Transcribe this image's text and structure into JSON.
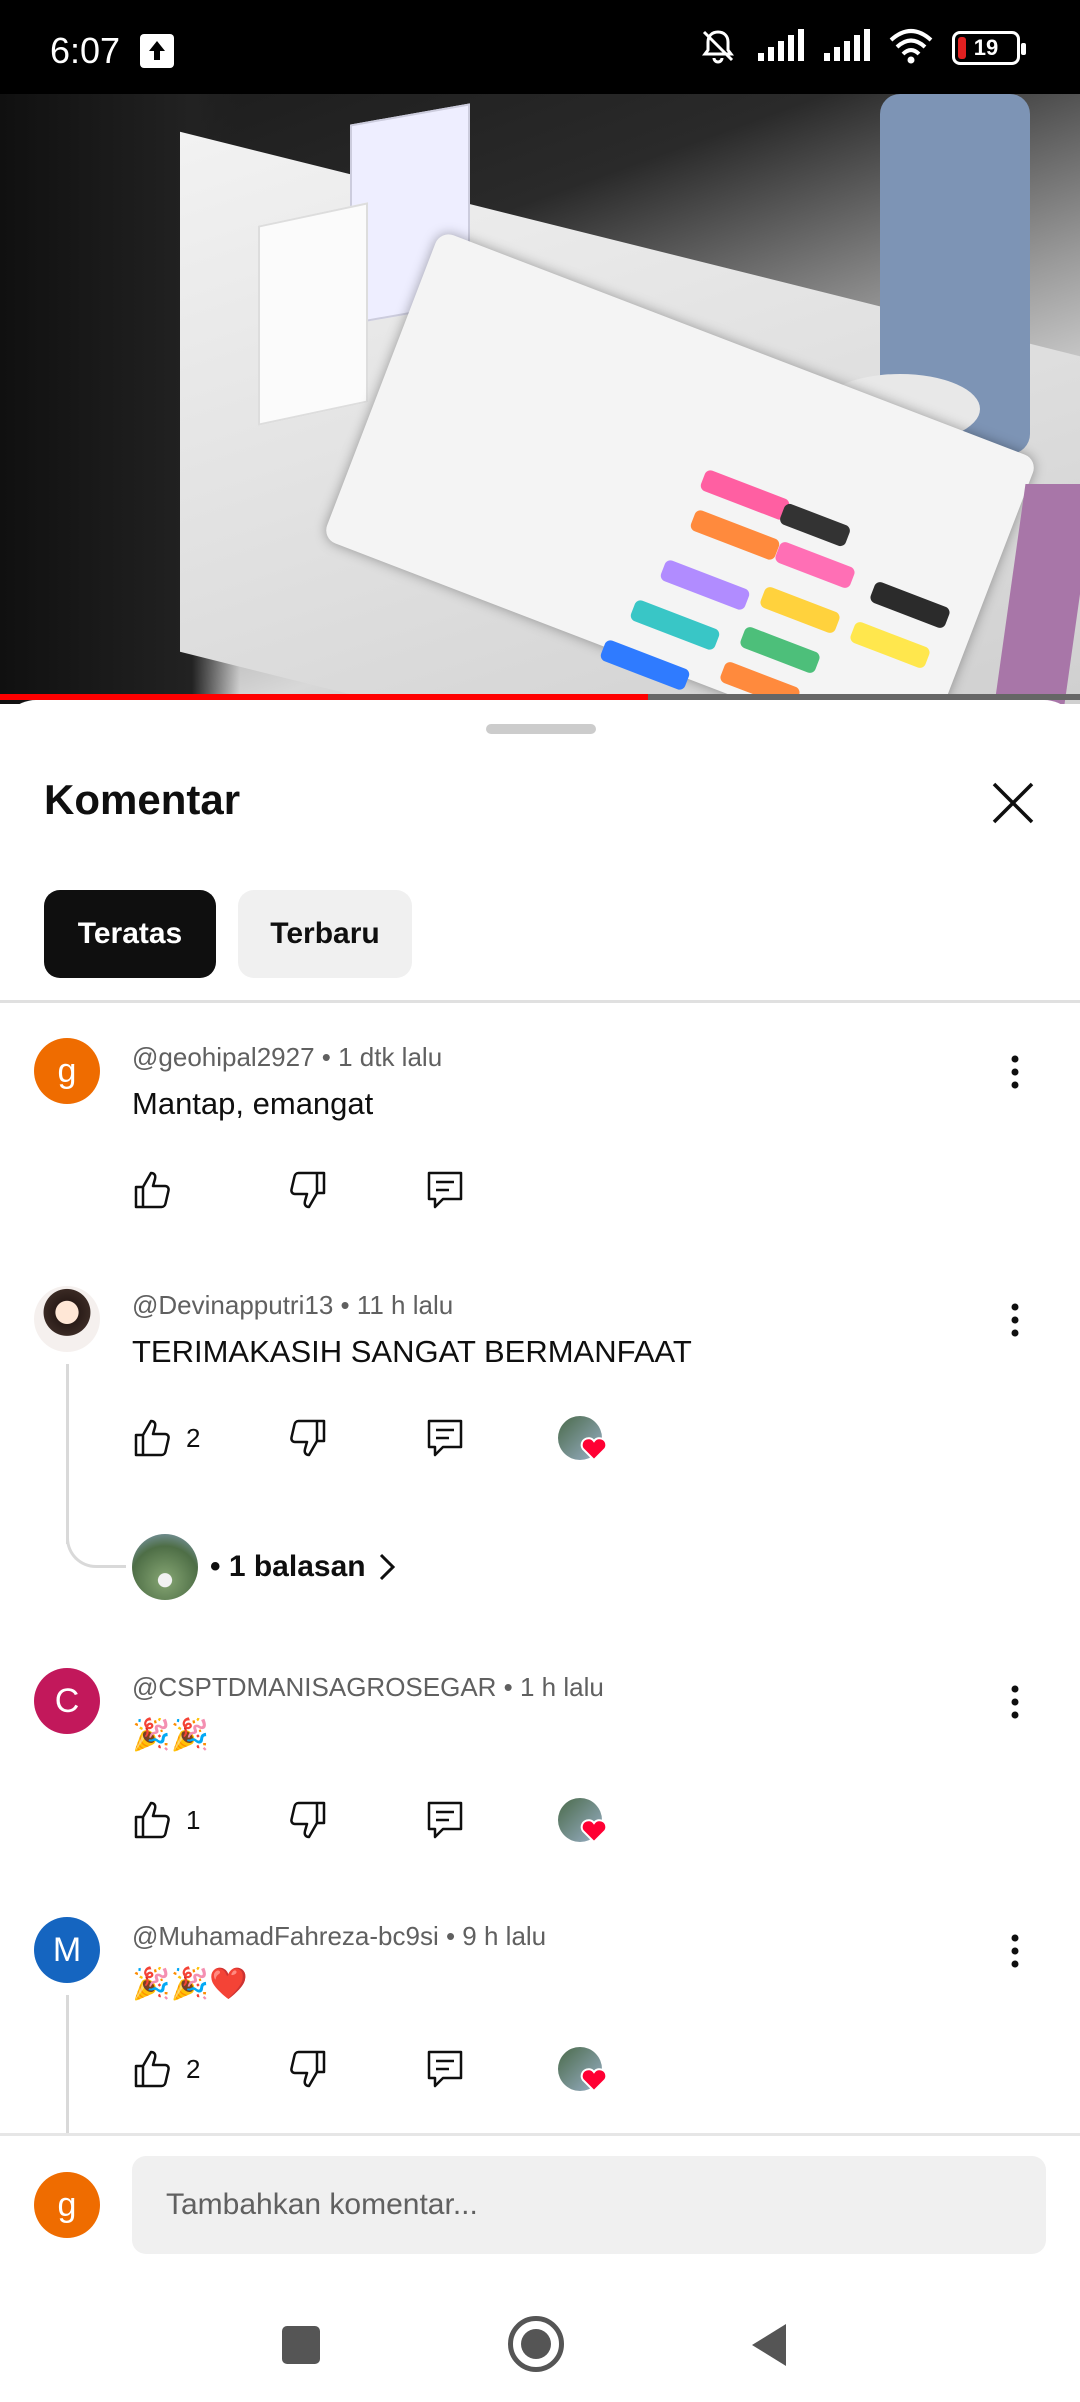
{
  "status_bar": {
    "time": "6:07",
    "battery": "19",
    "icons": [
      "upload-icon",
      "mute-bell-icon",
      "signal-icon",
      "signal-icon",
      "wifi-icon",
      "battery-icon"
    ]
  },
  "video": {
    "progress": 0.6,
    "accent_color": "#ff0000"
  },
  "sheet": {
    "title": "Komentar",
    "close_icon": "close-icon",
    "tabs": [
      {
        "label": "Teratas",
        "active": true
      },
      {
        "label": "Terbaru",
        "active": false
      }
    ]
  },
  "comments": [
    {
      "author": "@geohipal2927",
      "time": "1 dtk lalu",
      "meta": "@geohipal2927 • 1 dtk lalu",
      "text": "Mantap, emangat",
      "likes": "",
      "avatar_letter": "g",
      "avatar_color": "#ef6c00",
      "creator_heart": false
    },
    {
      "author": "@Devinapputri13",
      "time": "11 h lalu",
      "meta": "@Devinapputri13 • 11 h lalu",
      "text": "TERIMAKASIH SANGAT BERMANFAAT",
      "likes": "2",
      "avatar_letter": "",
      "avatar_color": "#e8d8d0",
      "creator_heart": true,
      "replies_label": "• 1 balasan"
    },
    {
      "author": "@CSPTDMANISAGROSEGAR",
      "time": "1 h lalu",
      "meta": "@CSPTDMANISAGROSEGAR • 1 h lalu",
      "text": "🎉🎉",
      "likes": "1",
      "avatar_letter": "C",
      "avatar_color": "#c2185b",
      "creator_heart": true
    },
    {
      "author": "@MuhamadFahreza-bc9si",
      "time": "9 h lalu",
      "meta": "@MuhamadFahreza-bc9si • 9 h lalu",
      "text": "🎉🎉❤️",
      "likes": "2",
      "avatar_letter": "M",
      "avatar_color": "#1565c0",
      "creator_heart": true
    }
  ],
  "composer": {
    "avatar_letter": "g",
    "avatar_color": "#ef6c00",
    "placeholder": "Tambahkan komentar..."
  },
  "navbar": {
    "buttons": [
      "recents-button",
      "home-button",
      "back-button"
    ]
  }
}
